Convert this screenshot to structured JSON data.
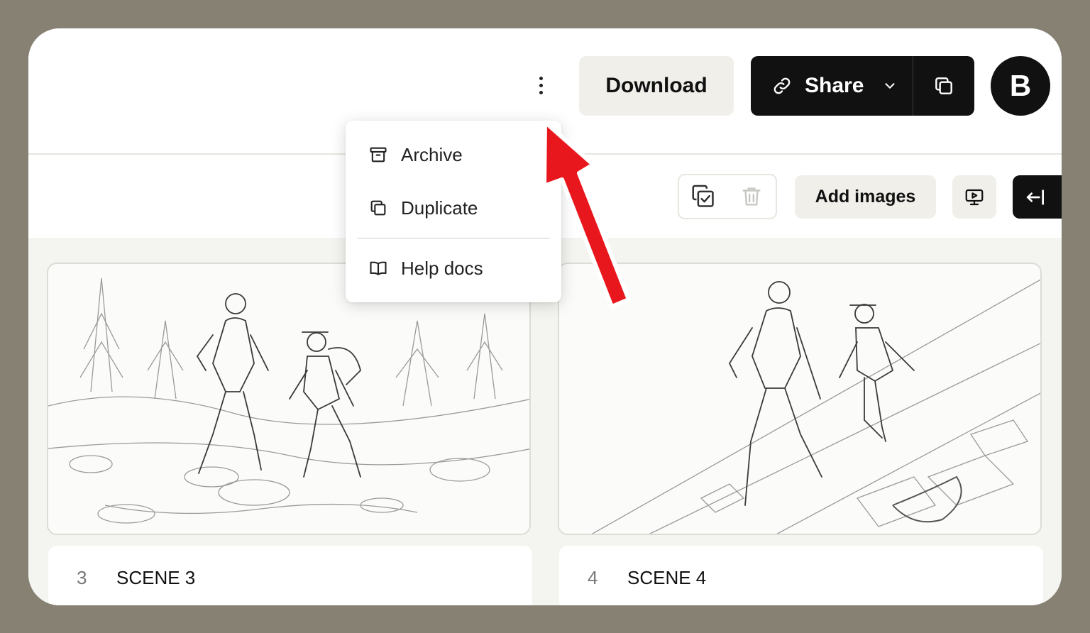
{
  "header": {
    "more_icon": "vertical-dots-icon",
    "download_label": "Download",
    "share_label": "Share",
    "avatar_letter": "B"
  },
  "toolbar": {
    "add_images_label": "Add images"
  },
  "menu": {
    "items": [
      {
        "label": "Archive",
        "icon": "archive-icon"
      },
      {
        "label": "Duplicate",
        "icon": "duplicate-icon"
      },
      {
        "label": "Help docs",
        "icon": "book-icon"
      }
    ]
  },
  "scenes": [
    {
      "number": "3",
      "name": "SCENE 3"
    },
    {
      "number": "4",
      "name": "SCENE 4"
    }
  ],
  "colors": {
    "frame": "#878173",
    "accent_dark": "#111111",
    "button_light": "#f0efea",
    "annotation_arrow": "#e8171d"
  }
}
